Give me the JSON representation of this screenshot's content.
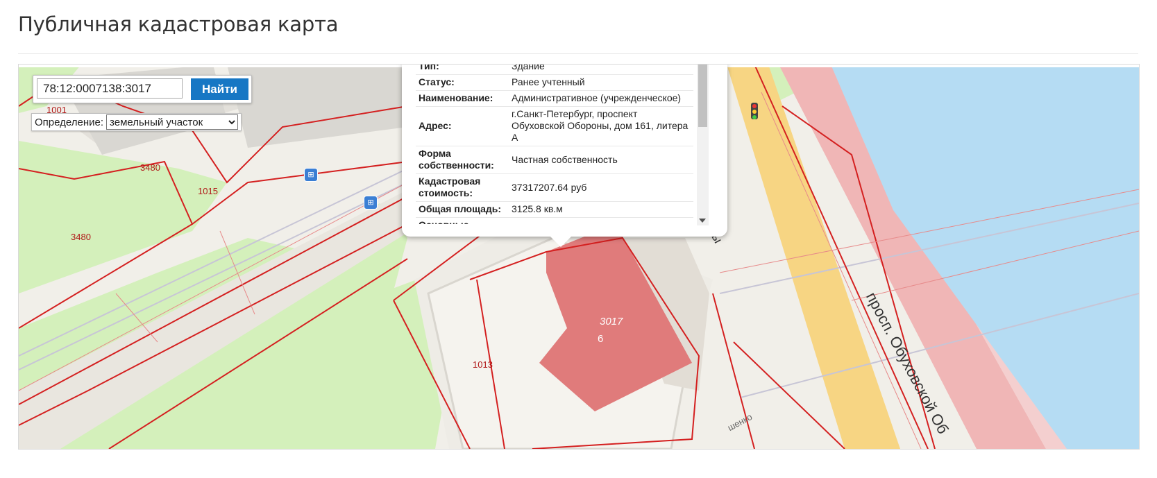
{
  "page": {
    "title": "Публичная кадастровая карта"
  },
  "search": {
    "value": "78:12:0007138:3017",
    "button_label": "Найти"
  },
  "definition": {
    "label": "Определение:",
    "selected": "земельный участок"
  },
  "popup": {
    "rows": [
      {
        "key": "Тип:",
        "value": "Здание"
      },
      {
        "key": "Статус:",
        "value": "Ранее учтенный"
      },
      {
        "key": "Наименование:",
        "value": "Административное (учрежденческое)"
      },
      {
        "key": "Адрес:",
        "value": "г.Санкт-Петербург, проспект Обуховской Обороны, дом 161, литера А"
      },
      {
        "key": "Форма собственности:",
        "value": "Частная собственность"
      },
      {
        "key": "Кадастровая стоимость:",
        "value": "37317207.64 руб"
      },
      {
        "key": "Общая площадь:",
        "value": "3125.8 кв.м"
      },
      {
        "key": "Основные",
        "value": ""
      }
    ]
  },
  "map": {
    "parcel_labels": [
      "1001",
      "3480",
      "1015",
      "3480",
      "1013"
    ],
    "building_label": "3017",
    "building_number": "6",
    "street_label": "просп. Обуховской Об",
    "street_fragment": "ы",
    "small_street": "шенко"
  },
  "colors": {
    "accent": "#1777c4",
    "parcel_border": "#d42020",
    "building": "#e07b7b",
    "river": "#b5dcf3",
    "green": "#d4f0bb",
    "road_yellow": "#f7d583",
    "road_pink": "#f0b6b6"
  },
  "icons": [
    "transit-icon",
    "transit-icon",
    "traffic-light-icon",
    "chevron-down-icon"
  ]
}
